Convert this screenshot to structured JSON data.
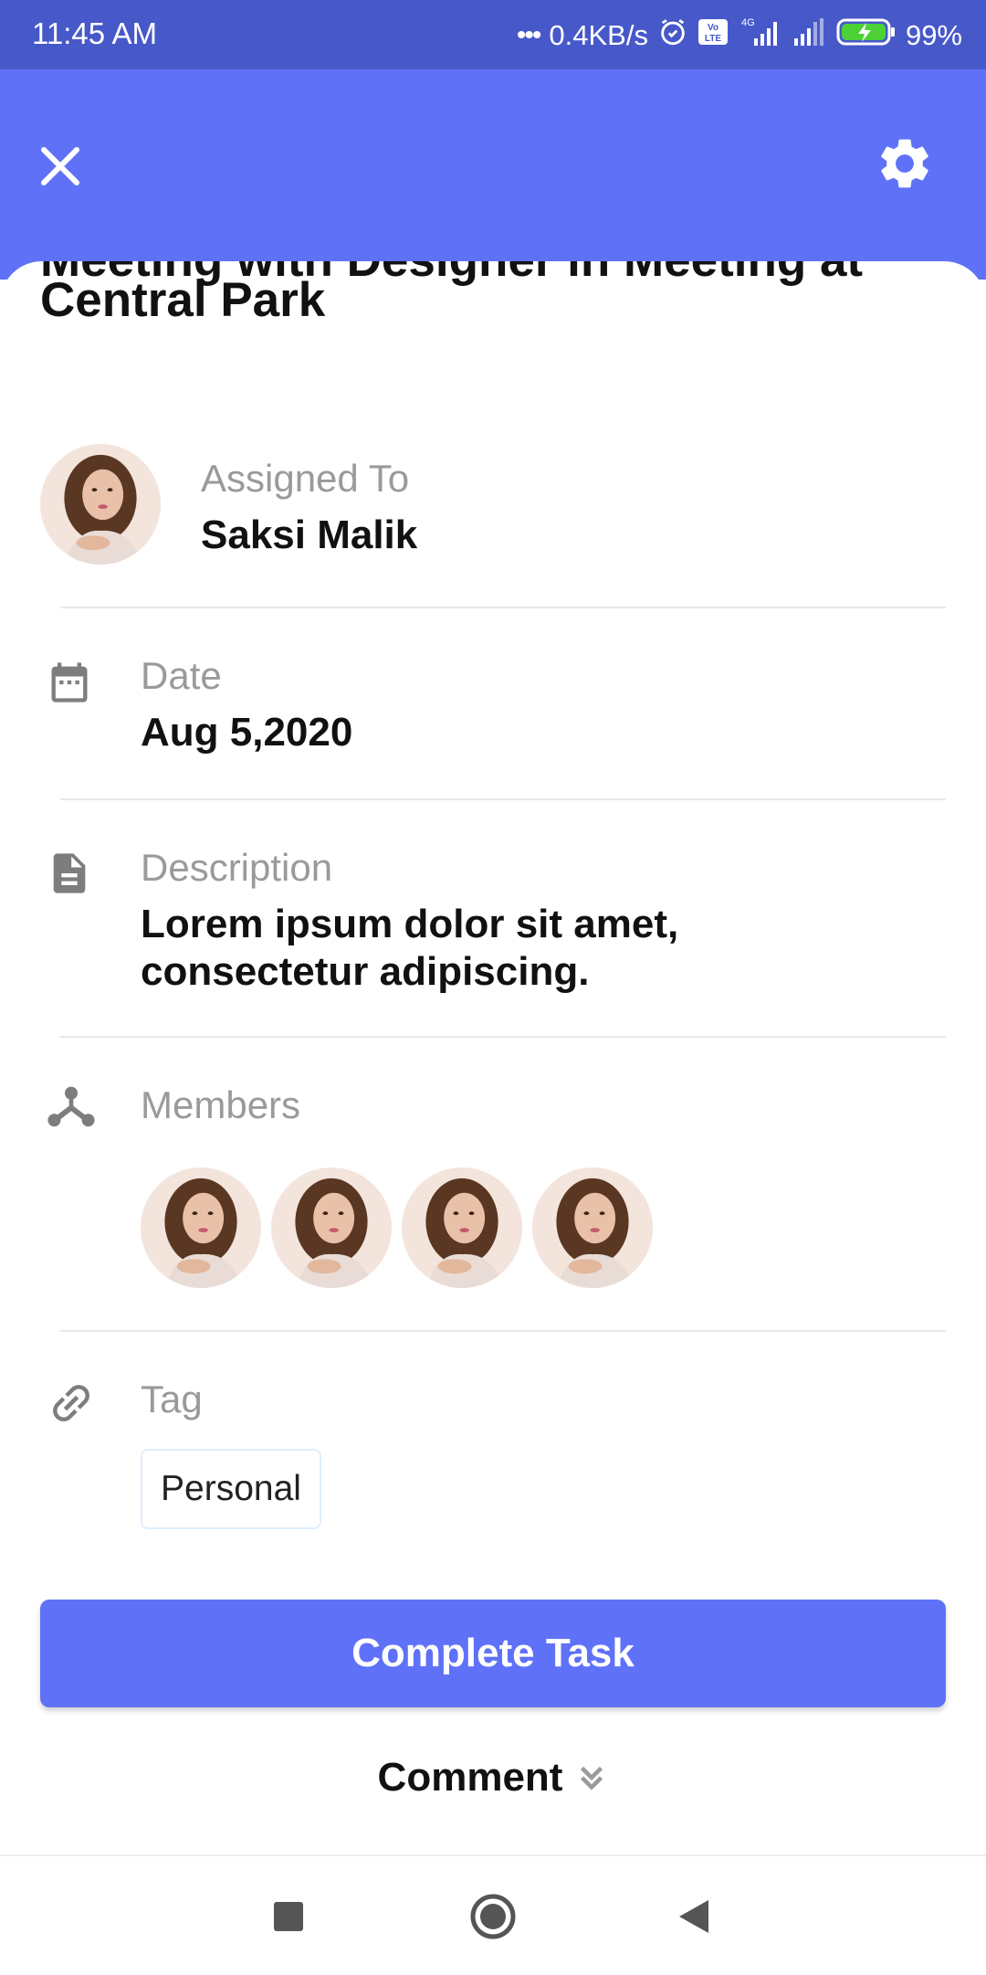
{
  "status_bar": {
    "time": "11:45 AM",
    "network_speed": "0.4KB/s",
    "network_type": "4G",
    "volte": "Vo LTE",
    "battery": "99%",
    "icons": [
      "alarm-icon",
      "volte-icon",
      "signal-icon",
      "signal-icon",
      "battery-charging-icon"
    ]
  },
  "app_bar": {
    "close_icon": "close-icon",
    "settings_icon": "gear-icon",
    "color": "#5f72f7"
  },
  "task": {
    "title_partial": "Meeting with Designer in Meeting at",
    "title": "Central Park",
    "assigned": {
      "label": "Assigned To",
      "name": "Saksi Malik"
    },
    "date": {
      "label": "Date",
      "value": "Aug 5,2020",
      "icon": "calendar-icon"
    },
    "description": {
      "label": "Description",
      "line1": "Lorem ipsum dolor sit amet,",
      "line2": "consectetur adipiscing.",
      "icon": "document-icon"
    },
    "members": {
      "label": "Members",
      "icon": "members-icon",
      "count": 4
    },
    "tag": {
      "label": "Tag",
      "value": "Personal",
      "icon": "link-icon"
    }
  },
  "actions": {
    "complete_label": "Complete Task",
    "comment_label": "Comment",
    "comment_icon": "double-chevron-down-icon"
  },
  "nav_bar": [
    "recents-button",
    "home-button",
    "back-button"
  ]
}
